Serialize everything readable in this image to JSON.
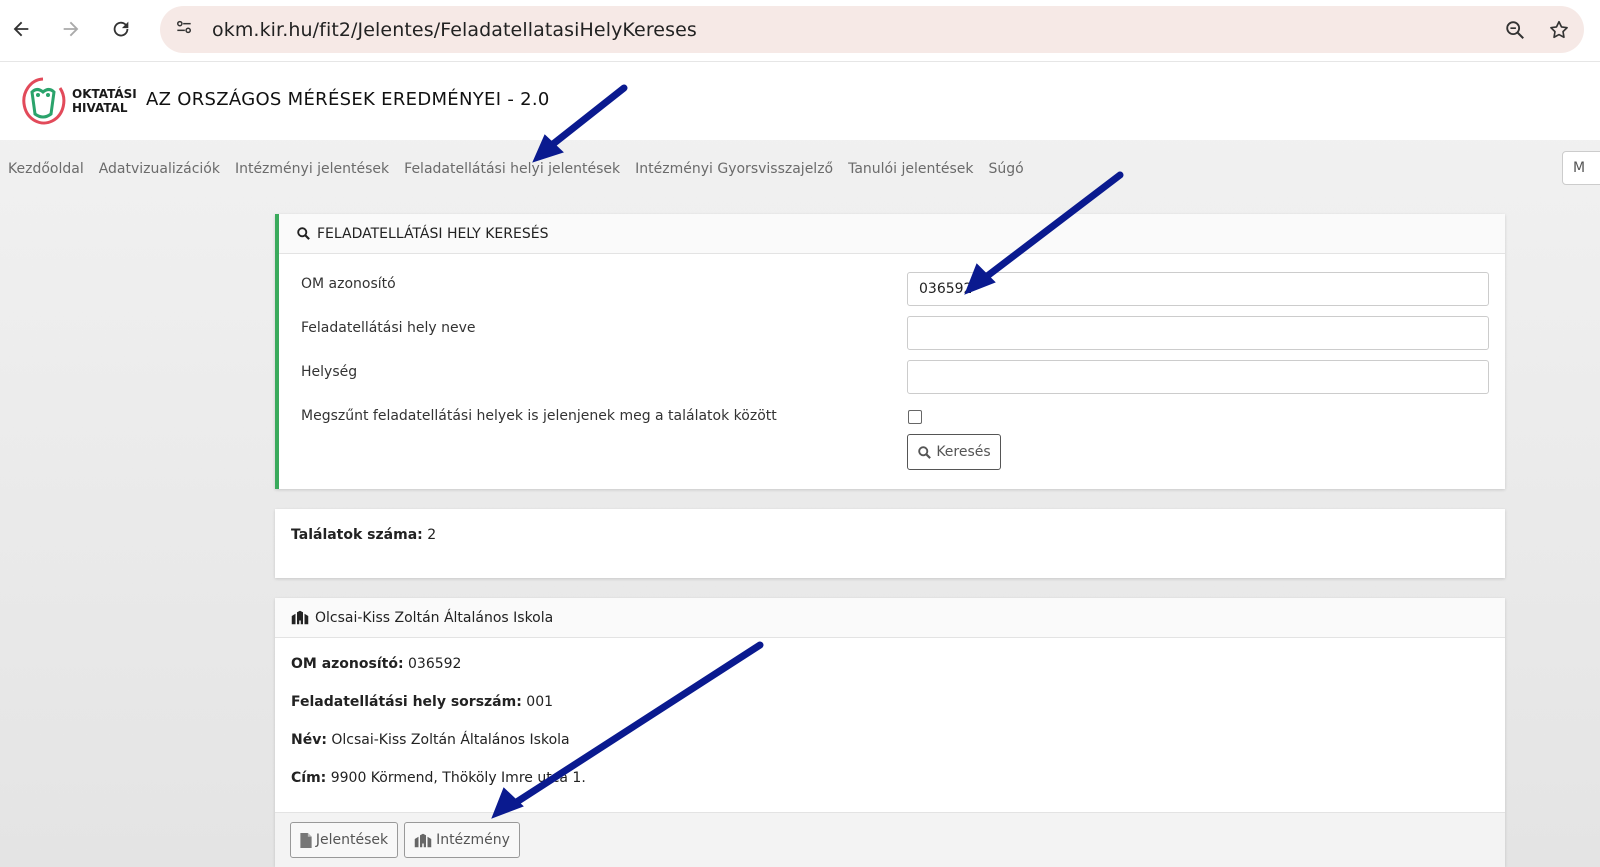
{
  "browser": {
    "url": "okm.kir.hu/fit2/Jelentes/FeladatellatasiHelyKereses"
  },
  "header": {
    "org_line1": "OKTATÁSI",
    "org_line2": "HIVATAL",
    "title": "AZ ORSZÁGOS MÉRÉSEK EREDMÉNYEI - 2.0",
    "logo_color": "#2aa36b",
    "logo_accent": "#e24a5a"
  },
  "nav": {
    "items": [
      "Kezdőoldal",
      "Adatvizualizációk",
      "Intézményi jelentések",
      "Feladatellátási helyi jelentések",
      "Intézményi Gyorsvisszajelző",
      "Tanulói jelentések",
      "Súgó"
    ],
    "right_button": "M"
  },
  "search": {
    "header": "FELADATELLÁTÁSI HELY KERESÉS",
    "om_label": "OM azonosító",
    "om_value": "036592",
    "name_label": "Feladatellátási hely neve",
    "name_value": "",
    "city_label": "Helység",
    "city_value": "",
    "closed_label": "Megszűnt feladatellátási helyek is jelenjenek meg a találatok között",
    "closed_checked": false,
    "button": "Keresés",
    "accent": "#3aaa5c"
  },
  "results": {
    "count_label": "Találatok száma:",
    "count_value": "2"
  },
  "result": {
    "title": "Olcsai-Kiss Zoltán Általános Iskola",
    "om_label": "OM azonosító:",
    "om_value": "036592",
    "seq_label": "Feladatellátási hely sorszám:",
    "seq_value": "001",
    "name_label": "Név:",
    "name_value": "Olcsai-Kiss Zoltán Általános Iskola",
    "address_label": "Cím:",
    "address_value": "9900 Körmend, Thököly Imre utca 1.",
    "btn_reports": "Jelentések",
    "btn_institution": "Intézmény"
  },
  "annotations": {
    "arrow_color": "#0a1a8f"
  }
}
